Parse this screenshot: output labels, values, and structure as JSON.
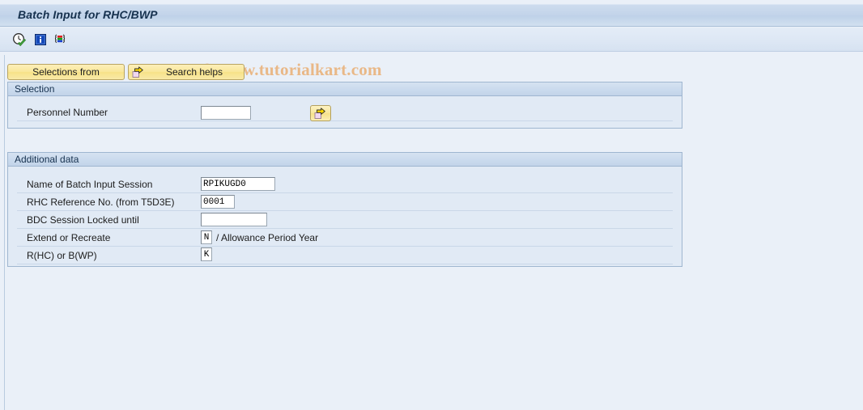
{
  "window": {
    "title": "Batch Input for RHC/BWP"
  },
  "watermark": {
    "text": "© www.tutorialkart.com",
    "color": "#e9b887"
  },
  "toolbar": {
    "icons": [
      {
        "name": "execute-check-icon",
        "label": "Execute"
      },
      {
        "name": "info-icon",
        "label": "Information"
      },
      {
        "name": "variants-icon",
        "label": "Get Variant"
      }
    ]
  },
  "tabs": [
    {
      "label": "Selections from",
      "icon": null
    },
    {
      "label": "Search helps",
      "icon": "yellow-arrow-icon"
    }
  ],
  "selection_panel": {
    "header": "Selection",
    "rows": [
      {
        "label": "Personnel Number",
        "value": "",
        "placeholder": ""
      }
    ],
    "multiple_selection_button": "multiple-selection-arrow"
  },
  "additional_panel": {
    "header": "Additional data",
    "rows": [
      {
        "label": "Name of Batch Input Session",
        "value": "RPIKUGD0",
        "suffix": ""
      },
      {
        "label": "RHC Reference No. (from T5D3E)",
        "value": "0001",
        "suffix": ""
      },
      {
        "label": "BDC Session Locked until",
        "value": "",
        "suffix": ""
      },
      {
        "label": "Extend or Recreate",
        "value": "N",
        "suffix": "/ Allowance Period Year"
      },
      {
        "label": "R(HC) or B(WP)",
        "value": "K",
        "suffix": ""
      }
    ]
  },
  "colors": {
    "background": "#eaf0f8",
    "panel_bg": "#e1eaf5",
    "title_text": "#16314e",
    "button_yellow": "#f7e288"
  }
}
